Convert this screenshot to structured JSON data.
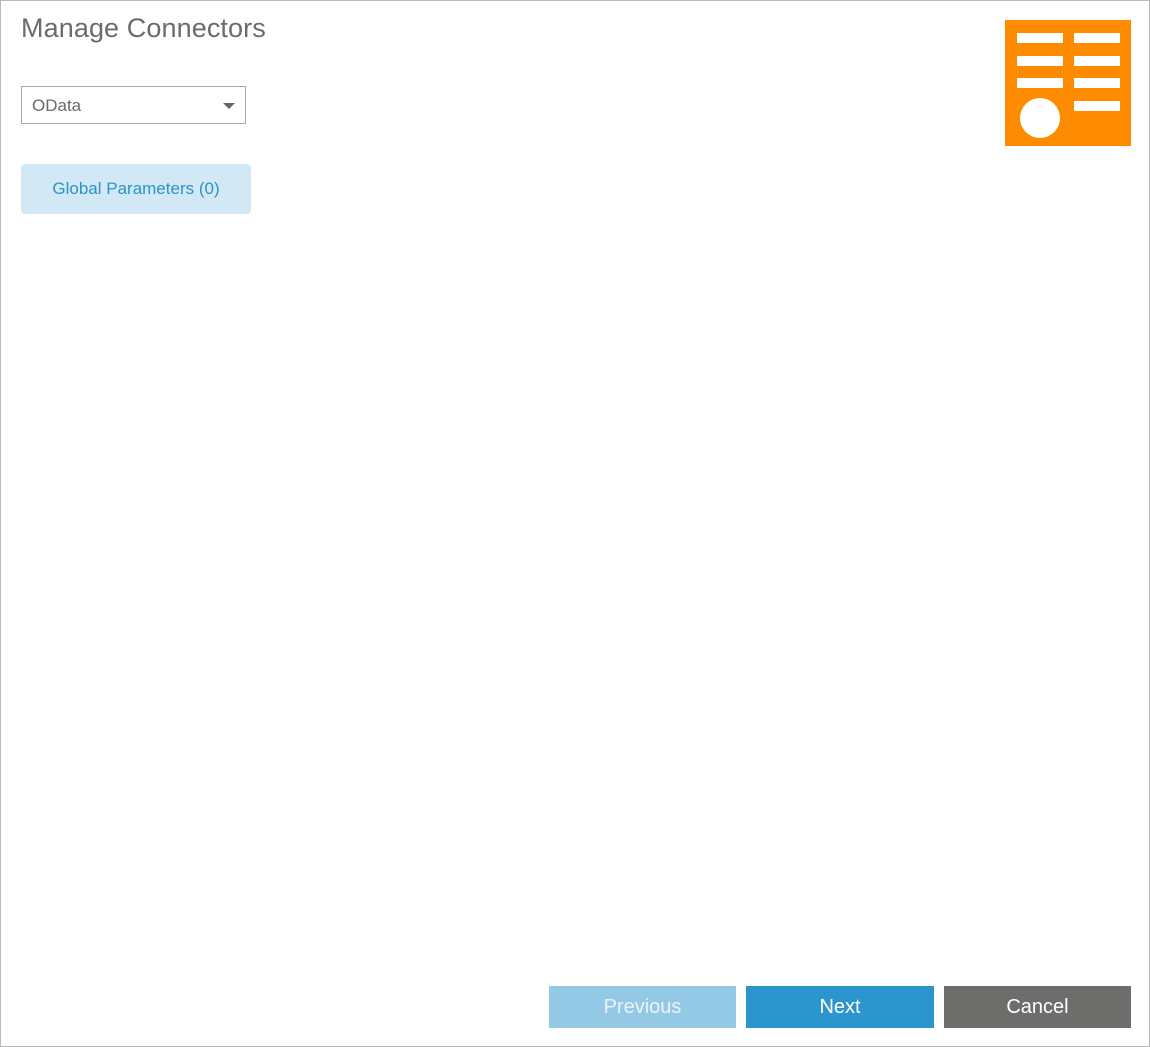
{
  "dialog": {
    "title": "Manage Connectors"
  },
  "connector_select": {
    "value": "OData"
  },
  "global_parameters": {
    "label": "Global Parameters (0)"
  },
  "footer": {
    "previous_label": "Previous",
    "next_label": "Next",
    "cancel_label": "Cancel"
  },
  "icons": {
    "logo": "connector-list-logo-icon",
    "caret": "chevron-down-icon"
  },
  "colors": {
    "logo": "#FF8C00",
    "primary": "#2A96CD",
    "primary_disabled": "#94C9E5",
    "secondary": "#6D6E6B",
    "global_params_bg": "#D2E8F4",
    "global_params_text": "#2A93C9"
  }
}
